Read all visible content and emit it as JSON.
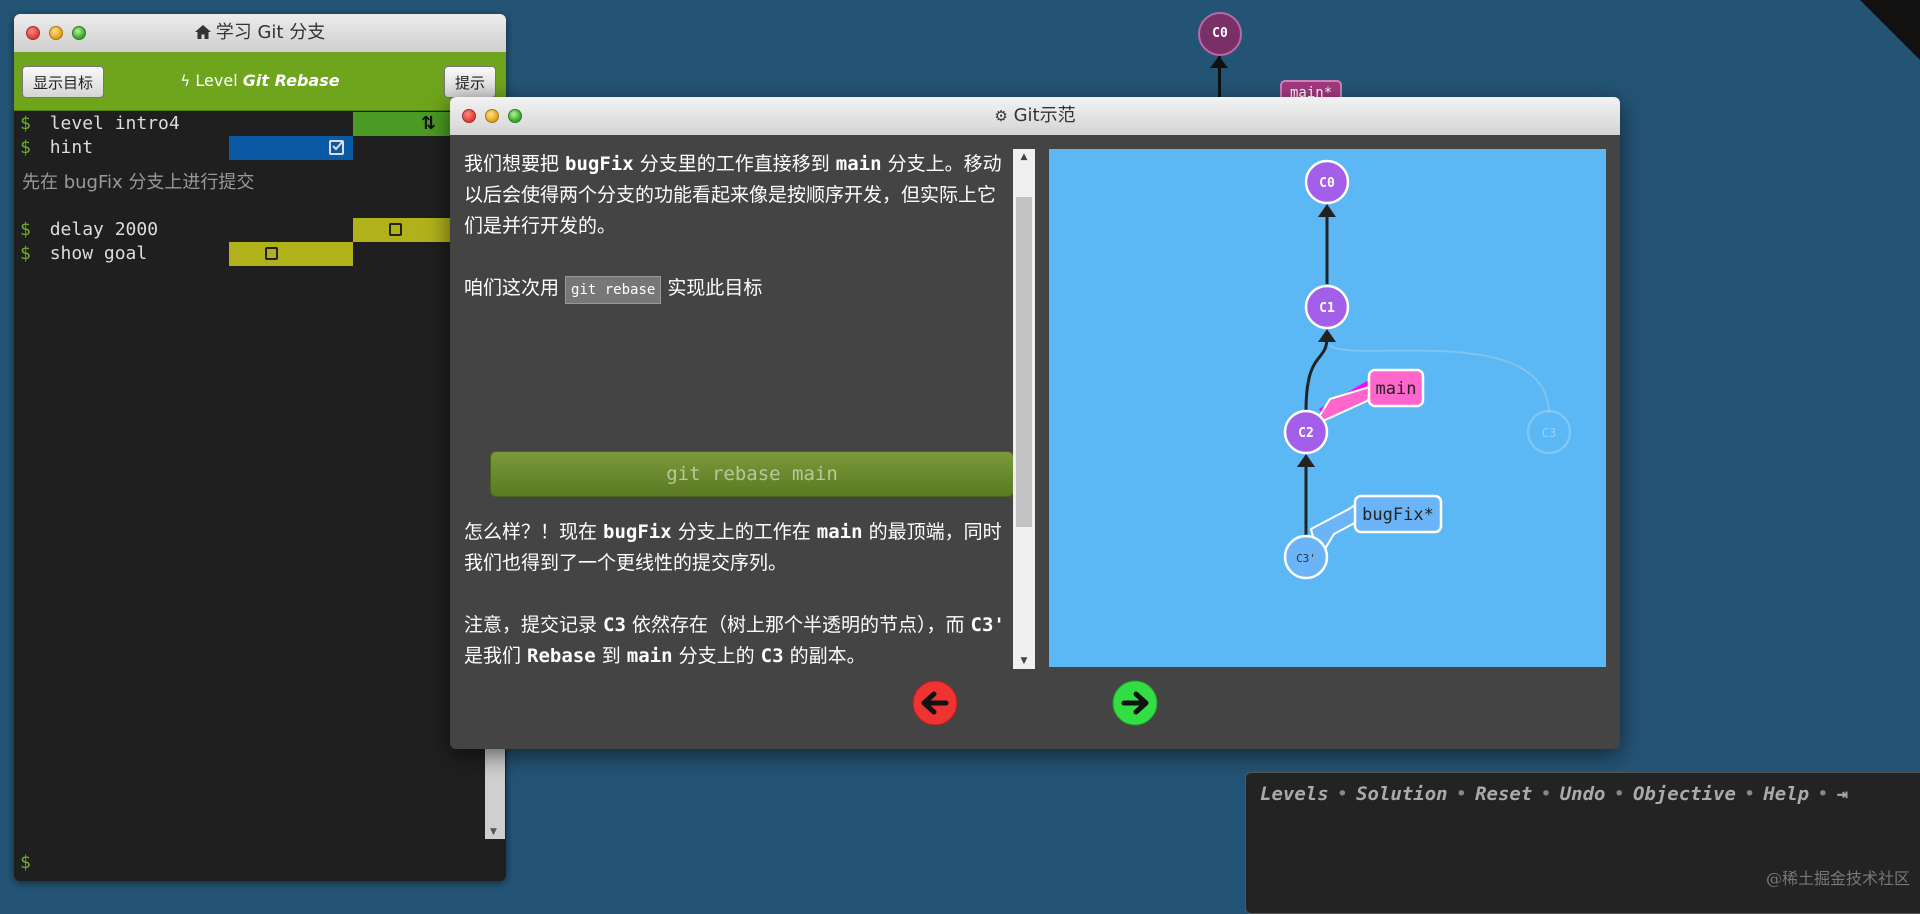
{
  "terminal": {
    "title": "学习 Git 分支",
    "show_goal_button": "显示目标",
    "level_prefix": "Level",
    "level_name": "Git Rebase",
    "hint_button": "提示",
    "commands": [
      {
        "prompt": "$",
        "text": "level intro4"
      },
      {
        "prompt": "$",
        "text": "hint"
      },
      {
        "prompt": "",
        "text": "先在 bugFix 分支上进行提交"
      },
      {
        "prompt": "$",
        "text": "delay 2000"
      },
      {
        "prompt": "$",
        "text": "show goal"
      }
    ],
    "input_prompt": "$"
  },
  "background": {
    "c0_label": "C0",
    "branch_label": "main*"
  },
  "modal": {
    "title": "Git示范",
    "para1_a": "我们想要把 ",
    "para1_b": "bugFix",
    "para1_c": " 分支里的工作直接移到 ",
    "para1_d": "main",
    "para1_e": " 分支上。移动以后会使得两个分支的功能看起来像是按顺序开发，但实际上它们是并行开发的。",
    "para2_a": "咱们这次用",
    "para2_code": "git rebase",
    "para2_b": "实现此目标",
    "command_button": "git rebase main",
    "para3_a": "怎么样？！现在 ",
    "para3_b": "bugFix",
    "para3_c": " 分支上的工作在 ",
    "para3_d": "main",
    "para3_e": " 的最顶端，同时我们也得到了一个更线性的提交序列。",
    "para4_a": "注意，提交记录 ",
    "para4_b": "C3",
    "para4_c": " 依然存在（树上那个半透明的节点），而 ",
    "para4_d": "C3'",
    "para4_e": " 是我们 ",
    "para4_f": "Rebase",
    "para4_g": " 到 ",
    "para4_h": "main",
    "para4_i": " 分支上的 ",
    "para4_j": "C3",
    "para4_k": " 的副本。",
    "graph": {
      "nodes": [
        "C0",
        "C1",
        "C2",
        "C3",
        "C3'"
      ],
      "branches": [
        "main",
        "bugFix*"
      ]
    }
  },
  "commandbar": {
    "links": [
      "Levels",
      "Solution",
      "Reset",
      "Undo",
      "Objective",
      "Help"
    ],
    "separator": "•"
  },
  "watermark": "@稀土掘金技术社区",
  "colors": {
    "background": "#245475",
    "commit_purple": "#a35fea",
    "main_branch": "#ff66cc",
    "bugfix_branch": "#6ab4f7",
    "viz_bg": "#5bb8f5"
  }
}
